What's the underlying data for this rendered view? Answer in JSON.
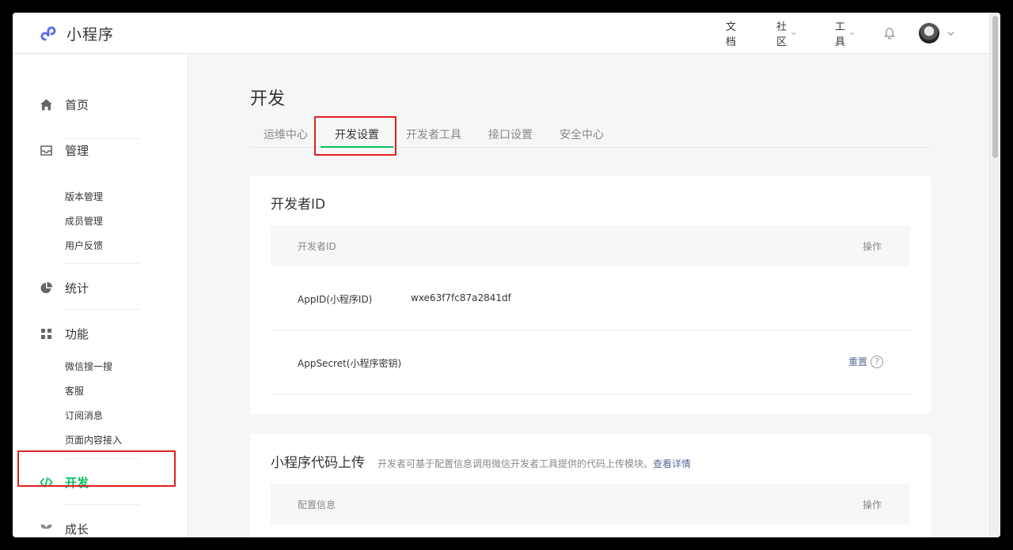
{
  "app": {
    "logo_text": "小程序"
  },
  "header": {
    "nav": {
      "docs": "文档",
      "community": "社区",
      "tools": "工具"
    }
  },
  "sidebar": {
    "home": "首页",
    "manage": {
      "title": "管理",
      "items": [
        "版本管理",
        "成员管理",
        "用户反馈"
      ]
    },
    "stats": "统计",
    "features": {
      "title": "功能",
      "items": [
        "微信搜一搜",
        "客服",
        "订阅消息",
        "页面内容接入"
      ]
    },
    "develop": "开发",
    "growth": "成长"
  },
  "main": {
    "title": "开发",
    "tabs": [
      "运维中心",
      "开发设置",
      "开发者工具",
      "接口设置",
      "安全中心"
    ],
    "active_tab": "开发设置",
    "developer_id_card": {
      "title": "开发者ID",
      "columns": {
        "name": "开发者ID",
        "action": "操作"
      },
      "rows": [
        {
          "label": "AppID(小程序ID)",
          "value": "wxe63f7fc87a2841df",
          "action": ""
        },
        {
          "label": "AppSecret(小程序密钥)",
          "value": "",
          "action": "重置"
        }
      ]
    },
    "upload_card": {
      "title": "小程序代码上传",
      "desc": "开发者可基于配置信息调用微信开发者工具提供的代码上传模块。",
      "desc_link": "查看详情",
      "columns": {
        "name": "配置信息",
        "action": "操作"
      }
    }
  },
  "colors": {
    "accent": "#07c160",
    "highlight": "#e02020",
    "link": "#576b95"
  }
}
